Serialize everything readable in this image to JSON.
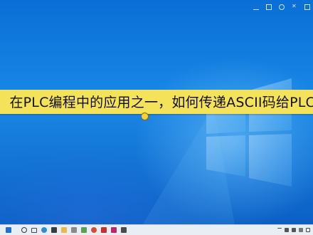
{
  "banner": {
    "text": "在PLC编程中的应用之一，如何传递ASCII码给PLC"
  },
  "colors": {
    "banner_bg": "#f5e25b",
    "desktop_bg": "#0a62c8",
    "taskbar_bg": "#e9eef4"
  },
  "taskbar": {
    "icons": [
      "windows-start-icon",
      "search-icon",
      "task-view-icon",
      "edge-icon",
      "store-icon",
      "file-explorer-icon",
      "app-icon",
      "app-icon",
      "app-icon",
      "app-icon",
      "app-icon",
      "app-icon"
    ]
  }
}
